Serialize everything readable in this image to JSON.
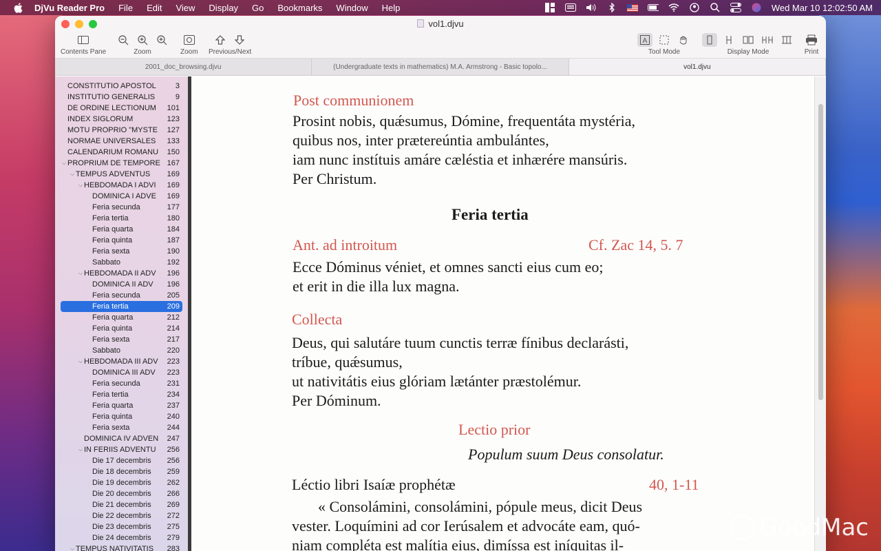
{
  "menubar": {
    "app_name": "DjVu Reader Pro",
    "items": [
      "File",
      "Edit",
      "View",
      "Display",
      "Go",
      "Bookmarks",
      "Window",
      "Help"
    ],
    "clock": "Wed Mar 10  12:02:50 AM",
    "icons": [
      "layout-icon",
      "keyboard-icon",
      "volume-icon",
      "bluetooth-icon",
      "flag-us-icon",
      "battery-icon",
      "wifi-icon",
      "user-icon",
      "search-icon",
      "control-center-icon",
      "siri-icon"
    ]
  },
  "window": {
    "title": "vol1.djvu",
    "toolbar": {
      "contents_pane": "Contents Pane",
      "zoom": "Zoom",
      "zoom2": "Zoom",
      "prev_next": "Previous/Next",
      "tool_mode": "Tool Mode",
      "display_mode": "Display Mode",
      "print": "Print"
    },
    "tabs": [
      "2001_doc_browsing.djvu",
      "(Undergraduate texts in mathematics) M.A. Armstrong - Basic topolo...",
      "vol1.djvu"
    ]
  },
  "toc": [
    {
      "title": "CONSTITUTIO APOSTOL",
      "page": "3",
      "indent": 0,
      "disc": ""
    },
    {
      "title": "INSTITUTIO GENERALIS",
      "page": "9",
      "indent": 0,
      "disc": ""
    },
    {
      "title": "DE ORDINE LECTIONUM",
      "page": "101",
      "indent": 0,
      "disc": ""
    },
    {
      "title": "INDEX SIGLORUM",
      "page": "123",
      "indent": 0,
      "disc": ""
    },
    {
      "title": "MOTU PROPRIO \"MYSTE",
      "page": "127",
      "indent": 0,
      "disc": ""
    },
    {
      "title": "NORMAE UNIVERSALES",
      "page": "133",
      "indent": 0,
      "disc": ""
    },
    {
      "title": "CALENDARIUM ROMANU",
      "page": "150",
      "indent": 0,
      "disc": ""
    },
    {
      "title": "PROPRIUM DE TEMPORE",
      "page": "167",
      "indent": 0,
      "disc": "v"
    },
    {
      "title": "TEMPUS ADVENTUS",
      "page": "169",
      "indent": 1,
      "disc": "v"
    },
    {
      "title": "HEBDOMADA I ADVI",
      "page": "169",
      "indent": 2,
      "disc": "v"
    },
    {
      "title": "DOMINICA I ADVE",
      "page": "169",
      "indent": 3,
      "disc": ""
    },
    {
      "title": "Feria secunda",
      "page": "177",
      "indent": 3,
      "disc": ""
    },
    {
      "title": "Feria tertia",
      "page": "180",
      "indent": 3,
      "disc": ""
    },
    {
      "title": "Feria quarta",
      "page": "184",
      "indent": 3,
      "disc": ""
    },
    {
      "title": "Feria quinta",
      "page": "187",
      "indent": 3,
      "disc": ""
    },
    {
      "title": "Feria sexta",
      "page": "190",
      "indent": 3,
      "disc": ""
    },
    {
      "title": "Sabbato",
      "page": "192",
      "indent": 3,
      "disc": ""
    },
    {
      "title": "HEBDOMADA II ADV",
      "page": "196",
      "indent": 2,
      "disc": "v"
    },
    {
      "title": "DOMINICA II ADV",
      "page": "196",
      "indent": 3,
      "disc": ""
    },
    {
      "title": "Feria secunda",
      "page": "205",
      "indent": 3,
      "disc": ""
    },
    {
      "title": "Feria tertia",
      "page": "209",
      "indent": 3,
      "disc": "",
      "selected": true
    },
    {
      "title": "Feria quarta",
      "page": "212",
      "indent": 3,
      "disc": ""
    },
    {
      "title": "Feria quinta",
      "page": "214",
      "indent": 3,
      "disc": ""
    },
    {
      "title": "Feria sexta",
      "page": "217",
      "indent": 3,
      "disc": ""
    },
    {
      "title": "Sabbato",
      "page": "220",
      "indent": 3,
      "disc": ""
    },
    {
      "title": "HEBDOMADA III ADV",
      "page": "223",
      "indent": 2,
      "disc": "v"
    },
    {
      "title": "DOMINICA III ADV",
      "page": "223",
      "indent": 3,
      "disc": ""
    },
    {
      "title": "Feria secunda",
      "page": "231",
      "indent": 3,
      "disc": ""
    },
    {
      "title": "Feria tertia",
      "page": "234",
      "indent": 3,
      "disc": ""
    },
    {
      "title": "Feria quarta",
      "page": "237",
      "indent": 3,
      "disc": ""
    },
    {
      "title": "Feria quinta",
      "page": "240",
      "indent": 3,
      "disc": ""
    },
    {
      "title": "Feria sexta",
      "page": "244",
      "indent": 3,
      "disc": ""
    },
    {
      "title": "DOMINICA IV ADVEN",
      "page": "247",
      "indent": 2,
      "disc": ""
    },
    {
      "title": "IN FERIIS ADVENTU",
      "page": "256",
      "indent": 2,
      "disc": "v"
    },
    {
      "title": "Die 17 decembris",
      "page": "256",
      "indent": 3,
      "disc": ""
    },
    {
      "title": "Die 18 decembris",
      "page": "259",
      "indent": 3,
      "disc": ""
    },
    {
      "title": "Die 19 decembris",
      "page": "262",
      "indent": 3,
      "disc": ""
    },
    {
      "title": "Die 20 decembris",
      "page": "266",
      "indent": 3,
      "disc": ""
    },
    {
      "title": "Die 21 decembris",
      "page": "269",
      "indent": 3,
      "disc": ""
    },
    {
      "title": "Die 22 decembris",
      "page": "272",
      "indent": 3,
      "disc": ""
    },
    {
      "title": "Die 23 decembris",
      "page": "275",
      "indent": 3,
      "disc": ""
    },
    {
      "title": "Die 24 decembris",
      "page": "279",
      "indent": 3,
      "disc": ""
    },
    {
      "title": "TEMPUS NATIVITATIS",
      "page": "283",
      "indent": 1,
      "disc": "v"
    }
  ],
  "page": {
    "post_communionem": "Post communionem",
    "pc_lines": [
      "Prosint nobis, quǽsumus, Dómine, frequentáta mystéria,",
      "quibus nos, inter prætereúntia ambulántes,",
      "iam nunc instítuis amáre cæléstia et inhærére mansúris.",
      "Per Christum."
    ],
    "feria_tertia": "Feria tertia",
    "ant_introitum": "Ant. ad introitum",
    "ant_ref": "Cf. Zac 14, 5. 7",
    "ant_lines": [
      "Ecce Dóminus véniet, et omnes sancti eius cum eo;",
      "et erit in die illa lux magna."
    ],
    "collecta": "Collecta",
    "collecta_lines": [
      "Deus, qui salutáre tuum cunctis terræ fínibus declarásti,",
      "tríbue, quǽsumus,",
      "ut nativitátis eius glóriam lætánter præstolémur.",
      "Per Dóminum."
    ],
    "lectio_prior": "Lectio prior",
    "populum": "Populum suum Deus consolatur.",
    "lectio_libri": "Léctio libri Isaíæ prophétæ",
    "lectio_ref": "40, 1-11",
    "lectio_lines": [
      "« Consolámini, consolámini, pópule meus, dicit Deus",
      "vester. Loquímini ad cor Ierúsalem et advocáte eam, quó-",
      "niam compléta est malítia eius, dimíssa est iníquitas il-"
    ]
  },
  "watermark": "GoodMac",
  "colors": {
    "rubric_red": "#d2574e",
    "selection_blue": "#2a6fe0"
  }
}
